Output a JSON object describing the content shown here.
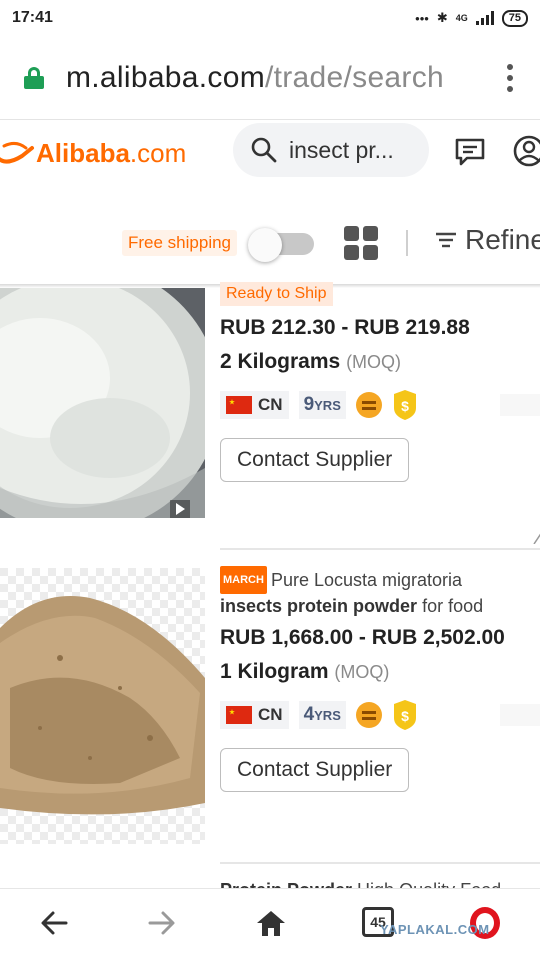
{
  "status": {
    "time": "17:41",
    "network": "4G",
    "battery": "75"
  },
  "browser": {
    "url_host": "m.alibaba.com",
    "url_path": "/trade/search",
    "menu_icon": "kebab-menu-icon",
    "secure_icon": "lock-icon"
  },
  "header": {
    "logo_text": "Alibaba",
    "logo_suffix": ".com",
    "search_value": "insect pr...",
    "brand_color": "#ff6a00"
  },
  "filters": {
    "free_shipping_label": "Free shipping",
    "refine_label": "Refine"
  },
  "products": [
    {
      "tag": "Ready to Ship",
      "price": "RUB 212.30 - RUB 219.88",
      "moq_qty": "2 Kilograms",
      "moq_tag": "(MOQ)",
      "country": "CN",
      "years_num": "9",
      "years_unit": "YRS",
      "contact_label": "Contact Supplier"
    },
    {
      "promo": "MARCH",
      "title_plain1": "Pure Locusta migratoria",
      "title_bold": "insects protein powder",
      "title_plain2": "for food",
      "price": "RUB 1,668.00 - RUB 2,502.00",
      "moq_qty": "1 Kilogram",
      "moq_tag": "(MOQ)",
      "country": "CN",
      "years_num": "4",
      "years_unit": "YRS",
      "contact_label": "Contact Supplier"
    },
    {
      "title_bold": "Protein Powder",
      "title_plain": "High Quality Food"
    }
  ],
  "bottom_nav": {
    "tab_count": "45",
    "watermark": "YAPLAKAL.COM"
  }
}
